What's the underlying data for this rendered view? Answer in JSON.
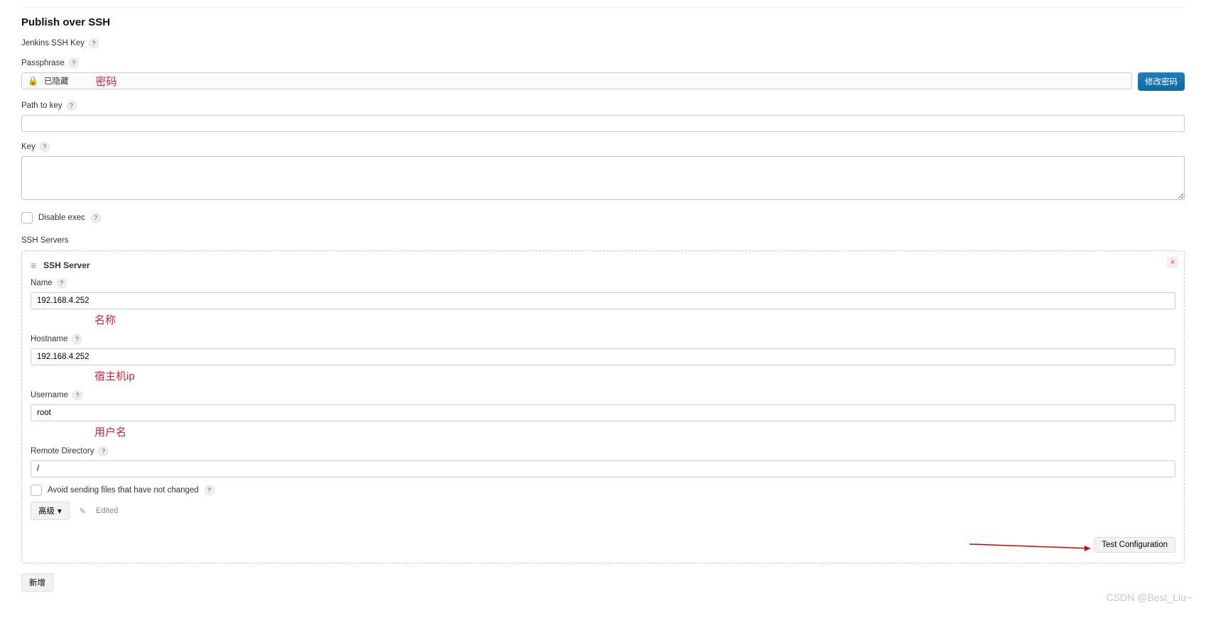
{
  "section": {
    "title": "Publish over SSH"
  },
  "ssh_key_section": {
    "label": "Jenkins SSH Key"
  },
  "passphrase": {
    "label": "Passphrase",
    "hidden_text": "已隐藏",
    "change_btn": "修改密码",
    "note": "密码"
  },
  "path_to_key": {
    "label": "Path to key",
    "value": ""
  },
  "key": {
    "label": "Key",
    "value": ""
  },
  "disable_exec": {
    "label": "Disable exec"
  },
  "ssh_servers": {
    "label": "SSH Servers"
  },
  "server": {
    "header": "SSH Server",
    "name_label": "Name",
    "name_value": "192.168.4.252",
    "name_note": "名称",
    "host_label": "Hostname",
    "host_value": "192.168.4.252",
    "host_note": "宿主机ip",
    "user_label": "Username",
    "user_value": "root",
    "user_note": "用户名",
    "remote_label": "Remote Directory",
    "remote_value": "/",
    "avoid_label": "Avoid sending files that have not changed",
    "advanced_btn": "高级",
    "edited_label": "Edited",
    "test_btn": "Test Configuration"
  },
  "add_btn": "新增",
  "watermark": "CSDN @Best_Liu~"
}
